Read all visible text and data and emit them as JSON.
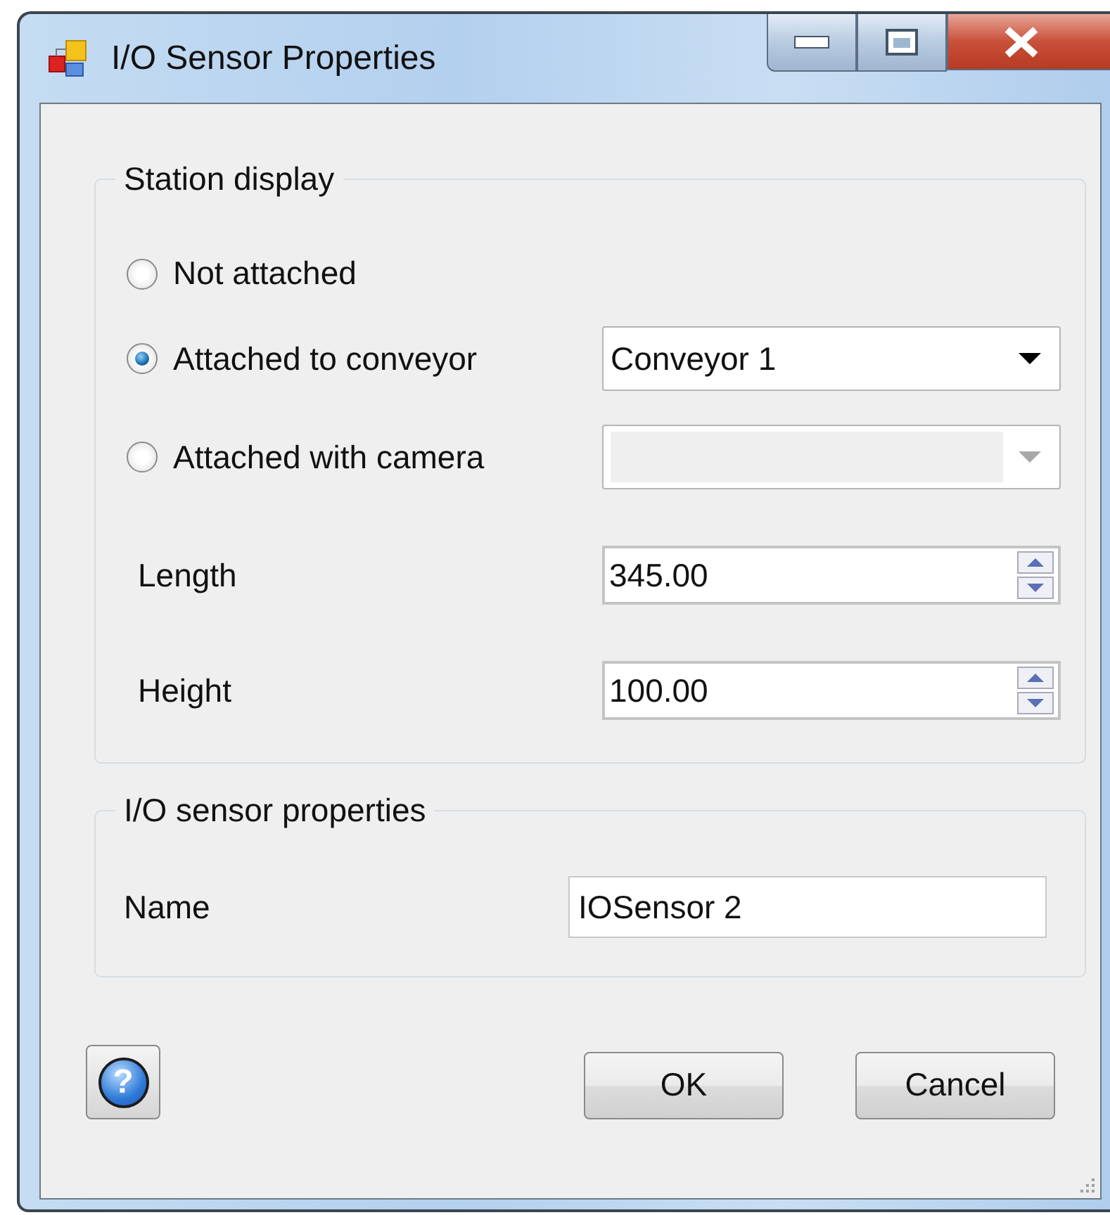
{
  "window": {
    "title": "I/O Sensor Properties"
  },
  "station_display": {
    "title": "Station display",
    "options": [
      {
        "label": "Not attached",
        "selected": false
      },
      {
        "label": "Attached to conveyor",
        "selected": true,
        "combo": {
          "value": "Conveyor 1",
          "disabled": false
        }
      },
      {
        "label": "Attached with camera",
        "selected": false,
        "combo": {
          "disabled": true
        }
      }
    ],
    "fields": [
      {
        "label": "Length",
        "value": "345.00"
      },
      {
        "label": "Height",
        "value": "100.00"
      }
    ]
  },
  "sensor": {
    "title": "I/O sensor properties",
    "name_label": "Name",
    "name_value": "IOSensor 2"
  },
  "help_button": {
    "glyph": "?"
  },
  "buttons": [
    {
      "label": "OK"
    },
    {
      "label": "Cancel"
    }
  ]
}
